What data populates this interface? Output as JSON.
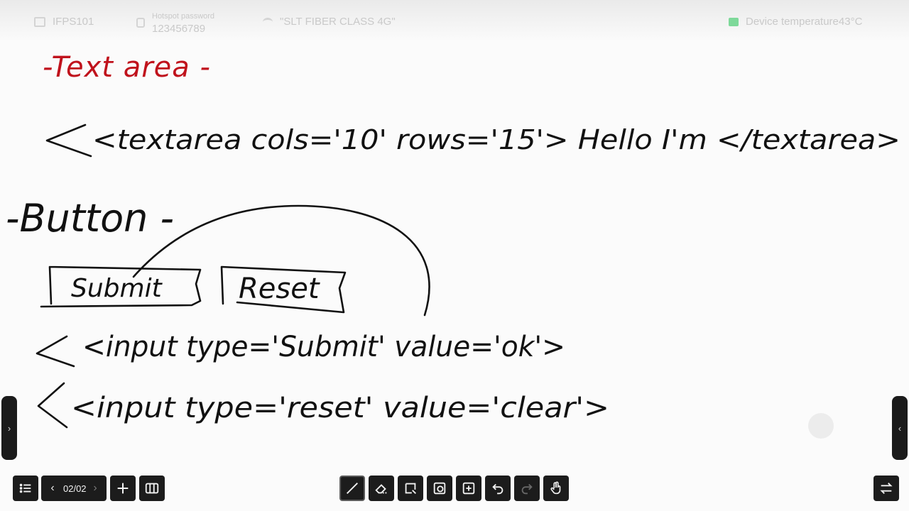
{
  "status": {
    "device_name": "IFPS101",
    "hotspot_label": "Hotspot password",
    "hotspot_password": "123456789",
    "wifi_name": "\"SLT FIBER CLASS 4G\"",
    "temperature": "Device temperature43°C"
  },
  "board": {
    "line1": "-Text area -",
    "line2": "<textarea cols='10' rows='15'> Hello I'm </textarea>",
    "line3": "-Button -",
    "submit_box": "Submit",
    "reset_box": "Reset",
    "line4": "<input type='Submit' value='ok'>",
    "line5": "<input type='reset' value='clear'>"
  },
  "toolbar": {
    "page_indicator": "02/02",
    "icons": {
      "menu": "list-icon",
      "prev": "chevron-left-icon",
      "next": "chevron-right-icon",
      "add": "plus-icon",
      "pages": "page-overview-icon",
      "pen": "pen-icon",
      "eraser": "eraser-icon",
      "select": "lasso-select-icon",
      "shapes": "shapes-icon",
      "insert": "insert-icon",
      "undo": "undo-icon",
      "redo": "redo-icon",
      "touch": "hand-touch-icon",
      "swap": "swap-icon"
    }
  },
  "colors": {
    "ink_red": "#c0121c",
    "ink_black": "#111111",
    "toolbar_bg": "#1c1c1c"
  }
}
